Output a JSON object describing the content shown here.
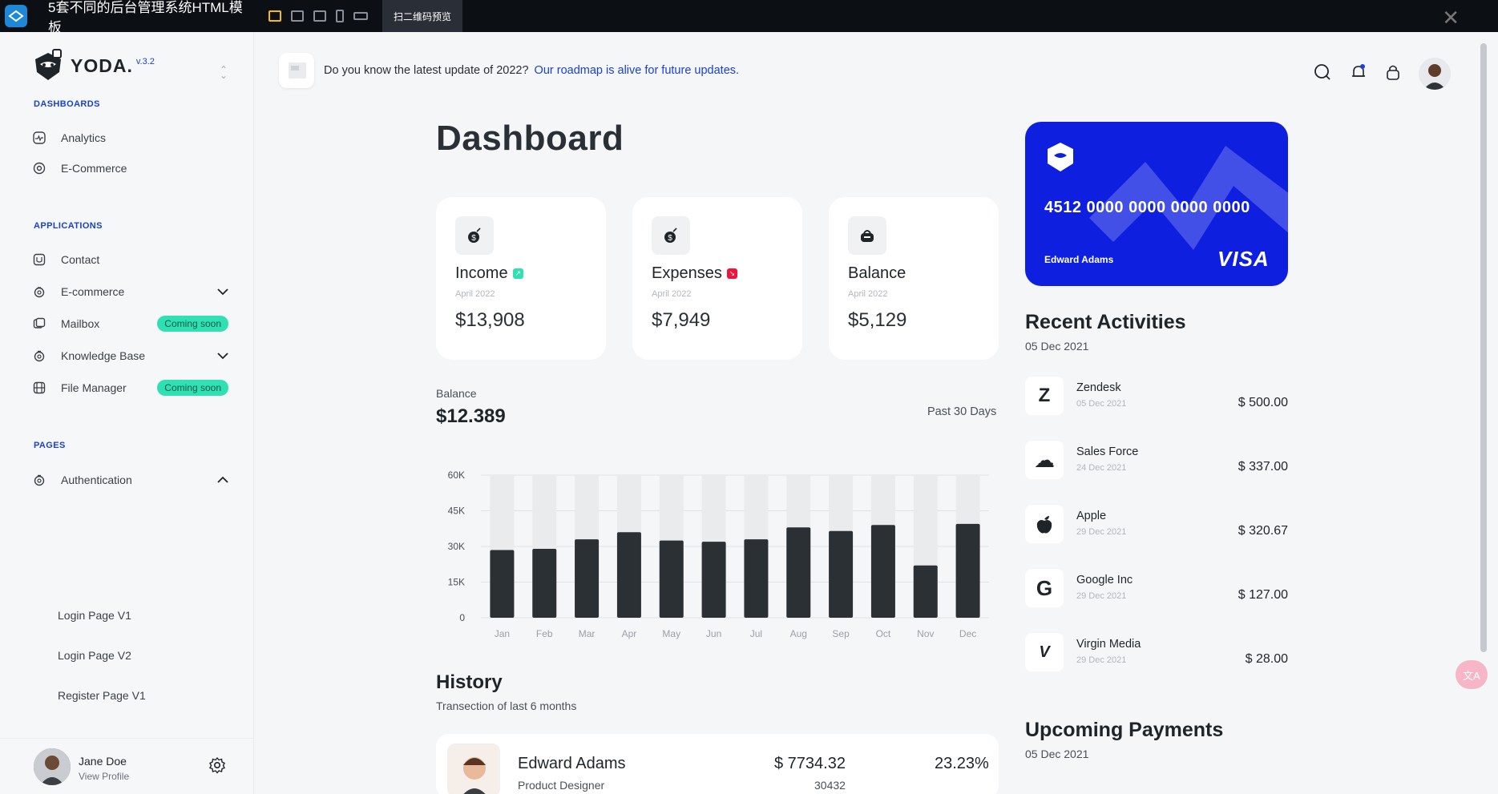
{
  "topbar": {
    "title": "5套不同的后台管理系统HTML模板",
    "qr_label": "扫二维码预览",
    "device_icons": [
      "desktop-icon",
      "tablet-portrait-icon",
      "tablet-landscape-icon",
      "phone-icon",
      "wide-icon"
    ]
  },
  "brand": {
    "name": "YODA.",
    "version": "v.3.2"
  },
  "sidebar": {
    "sections": {
      "dashboards": "DASHBOARDS",
      "applications": "APPLICATIONS",
      "pages": "PAGES"
    },
    "dashboards": [
      {
        "label": "Analytics",
        "icon": "analytics-icon"
      },
      {
        "label": "E-Commerce",
        "icon": "target-icon"
      }
    ],
    "applications": [
      {
        "label": "Contact",
        "icon": "contact-icon"
      },
      {
        "label": "E-commerce",
        "icon": "ecommerce-icon",
        "has_chevron": true
      },
      {
        "label": "Mailbox",
        "icon": "mailbox-icon",
        "badge": "Coming soon"
      },
      {
        "label": "Knowledge Base",
        "icon": "knowledge-icon",
        "has_chevron": true
      },
      {
        "label": "File Manager",
        "icon": "file-icon",
        "badge": "Coming soon"
      }
    ],
    "pages": [
      {
        "label": "Authentication",
        "icon": "auth-icon",
        "expanded": true
      }
    ],
    "auth_children": [
      "Login Page V1",
      "Login Page V2",
      "Register Page V1"
    ],
    "profile": {
      "name": "Jane Doe",
      "link": "View Profile"
    }
  },
  "header": {
    "notice_text": "Do you know the latest update of 2022?",
    "notice_link": "Our roadmap is alive for future updates."
  },
  "main": {
    "title": "Dashboard",
    "stats": [
      {
        "label": "Income",
        "date": "April 2022",
        "value": "$13,908",
        "indicator_color": "#2fe0b3",
        "icon": "money-bag-icon"
      },
      {
        "label": "Expenses",
        "date": "April 2022",
        "value": "$7,949",
        "indicator_color": "#f0143c",
        "icon": "money-bag-icon"
      },
      {
        "label": "Balance",
        "date": "April 2022",
        "value": "$5,129",
        "icon": "wallet-icon"
      }
    ],
    "balance": {
      "label": "Balance",
      "value": "$12.389",
      "range": "Past 30 Days"
    },
    "history": {
      "title": "History",
      "subtitle": "Transection of last 6 months",
      "row": {
        "name": "Edward Adams",
        "role": "Product Designer",
        "amount": "$ 7734.32",
        "count": "30432",
        "percent": "23.23%"
      }
    }
  },
  "chart_data": {
    "type": "bar",
    "categories": [
      "Jan",
      "Feb",
      "Mar",
      "Apr",
      "May",
      "Jun",
      "Jul",
      "Aug",
      "Sep",
      "Oct",
      "Nov",
      "Dec"
    ],
    "values": [
      28500,
      29000,
      33000,
      36000,
      32500,
      32000,
      33000,
      38000,
      36500,
      39000,
      22000,
      39500
    ],
    "ylim": [
      0,
      60000
    ],
    "yticks": [
      "0",
      "15K",
      "30K",
      "45K",
      "60K"
    ],
    "ytick_values": [
      0,
      15000,
      30000,
      45000,
      60000
    ],
    "grid": true,
    "bar_color": "#2b3034",
    "track_color": "#eaebed"
  },
  "card": {
    "number": "4512 0000 0000 0000 0000",
    "holder": "Edward Adams",
    "brand": "VISA",
    "color": "#0f1fe0"
  },
  "activities": {
    "title": "Recent Activities",
    "date": "05 Dec 2021",
    "items": [
      {
        "name": "Zendesk",
        "date": "05 Dec 2021",
        "amount": "$ 500.00",
        "icon": "zendesk-icon",
        "glyph": "Z"
      },
      {
        "name": "Sales Force",
        "date": "24 Dec 2021",
        "amount": "$ 337.00",
        "icon": "salesforce-icon",
        "glyph": "☁"
      },
      {
        "name": "Apple",
        "date": "29 Dec 2021",
        "amount": "$ 320.67",
        "icon": "apple-icon",
        "glyph": ""
      },
      {
        "name": "Google Inc",
        "date": "29 Dec 2021",
        "amount": "$ 127.00",
        "icon": "google-icon",
        "glyph": "G"
      },
      {
        "name": "Virgin Media",
        "date": "29 Dec 2021",
        "amount": "$ 28.00",
        "icon": "virgin-icon",
        "glyph": "V"
      }
    ]
  },
  "upcoming": {
    "title": "Upcoming Payments",
    "date": "05 Dec 2021"
  },
  "translate_label": "文A"
}
